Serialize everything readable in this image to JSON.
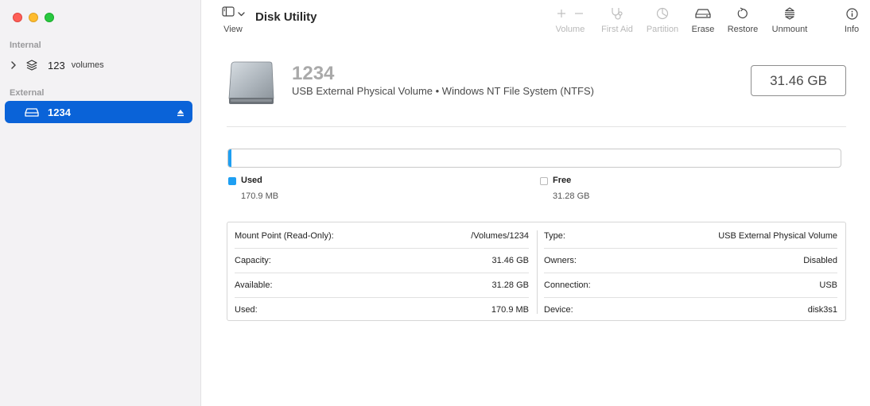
{
  "sidebar": {
    "internal_label": "Internal",
    "external_label": "External",
    "internal_items": [
      {
        "name": "123",
        "sub": "volumes",
        "icon": "stack-layers-icon"
      }
    ],
    "external_items": [
      {
        "name": "1234",
        "icon": "external-drive-icon",
        "selected": true
      }
    ]
  },
  "toolbar": {
    "view_label": "View",
    "title": "Disk Utility",
    "items": [
      {
        "label": "Volume",
        "icon": "plus-minus-icon",
        "enabled": false
      },
      {
        "label": "First Aid",
        "icon": "stethoscope-icon",
        "enabled": false
      },
      {
        "label": "Partition",
        "icon": "pie-partition-icon",
        "enabled": false
      },
      {
        "label": "Erase",
        "icon": "erase-drive-icon",
        "enabled": true
      },
      {
        "label": "Restore",
        "icon": "restore-arrow-icon",
        "enabled": true
      },
      {
        "label": "Unmount",
        "icon": "unmount-icon",
        "enabled": true
      },
      {
        "label": "Info",
        "icon": "info-icon",
        "enabled": true
      }
    ]
  },
  "volume": {
    "name": "1234",
    "description": "USB External Physical Volume • Windows NT File System (NTFS)",
    "capacity": "31.46 GB",
    "used_fraction": 0.0054,
    "used_label": "Used",
    "used_value": "170.9 MB",
    "free_label": "Free",
    "free_value": "31.28 GB",
    "used_color": "#1e9ff2"
  },
  "info": {
    "left": [
      {
        "key": "Mount Point (Read-Only):",
        "value": "/Volumes/1234"
      },
      {
        "key": "Capacity:",
        "value": "31.46 GB"
      },
      {
        "key": "Available:",
        "value": "31.28 GB"
      },
      {
        "key": "Used:",
        "value": "170.9 MB"
      }
    ],
    "right": [
      {
        "key": "Type:",
        "value": "USB External Physical Volume"
      },
      {
        "key": "Owners:",
        "value": "Disabled"
      },
      {
        "key": "Connection:",
        "value": "USB"
      },
      {
        "key": "Device:",
        "value": "disk3s1"
      }
    ]
  }
}
